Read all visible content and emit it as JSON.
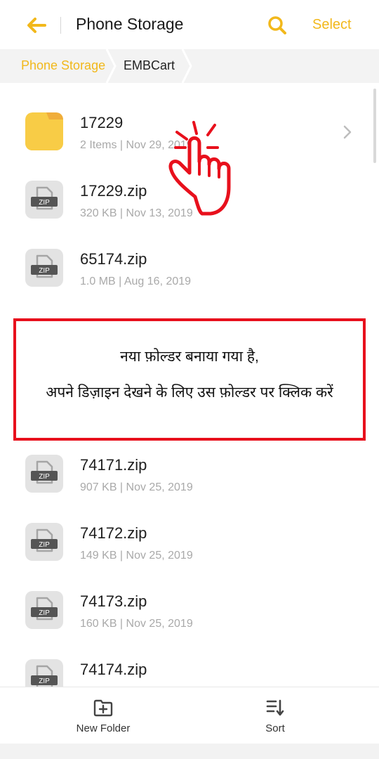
{
  "header": {
    "title": "Phone Storage",
    "select_label": "Select",
    "back_icon": "back-arrow-icon",
    "search_icon": "search-icon",
    "accent_color": "#F2B81B"
  },
  "breadcrumb": [
    "Phone Storage",
    "EMBCart"
  ],
  "files": [
    {
      "name": "17229",
      "meta": "2 Items | Nov 29, 2019",
      "type": "folder"
    },
    {
      "name": "17229.zip",
      "meta": "320 KB | Nov 13, 2019",
      "type": "zip"
    },
    {
      "name": "65174.zip",
      "meta": "1.0 MB | Aug 16, 2019",
      "type": "zip"
    },
    {
      "name": "74171.zip",
      "meta": "907 KB | Nov 25, 2019",
      "type": "zip"
    },
    {
      "name": "74172.zip",
      "meta": "149 KB | Nov 25, 2019",
      "type": "zip"
    },
    {
      "name": "74173.zip",
      "meta": "160 KB | Nov 25, 2019",
      "type": "zip"
    },
    {
      "name": "74174.zip",
      "meta": "",
      "type": "zip"
    }
  ],
  "zip_badge": "ZIP",
  "annotation": {
    "line1": "नया फ़ोल्डर बनाया गया है,",
    "line2": "अपने डिज़ाइन देखने के लिए उस फ़ोल्डर पर क्लिक करें",
    "border_color": "#E8101C"
  },
  "bottom_bar": {
    "new_folder_label": "New Folder",
    "sort_label": "Sort",
    "new_folder_icon": "new-folder-icon",
    "sort_icon": "sort-icon"
  }
}
